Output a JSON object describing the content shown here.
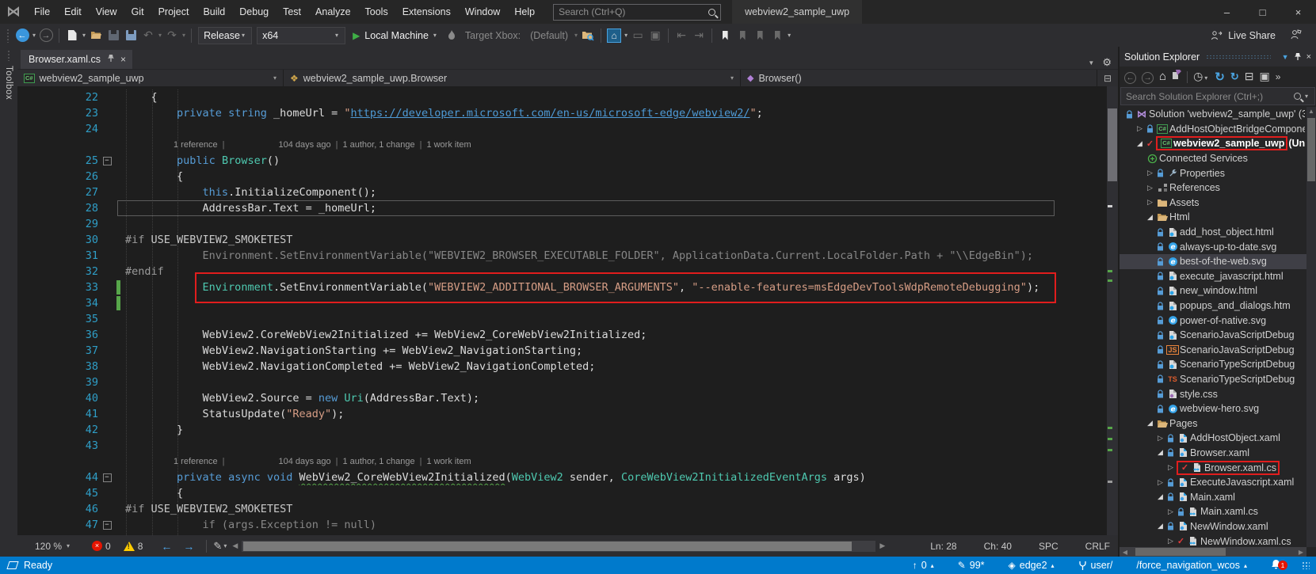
{
  "window": {
    "title": "webview2_sample_uwp",
    "search_placeholder": "Search (Ctrl+Q)",
    "controls": {
      "minimize": "–",
      "maximize": "□",
      "close": "×"
    }
  },
  "menubar": {
    "items": [
      "File",
      "Edit",
      "View",
      "Git",
      "Project",
      "Build",
      "Debug",
      "Test",
      "Analyze",
      "Tools",
      "Extensions",
      "Window",
      "Help"
    ]
  },
  "toolbar": {
    "configuration": "Release",
    "platform": "x64",
    "run_target": "Local Machine",
    "target_label": "Target Xbox:",
    "target_value": "(Default)",
    "live_share": "Live Share",
    "icons": [
      "nav-back",
      "nav-forward",
      "new-project",
      "open-file",
      "save",
      "save-all",
      "undo",
      "redo",
      "performance-flame",
      "find-in-files",
      "attach-home",
      "navigate-backward-code",
      "navigate-forward-code",
      "decrease-indent",
      "increase-indent",
      "toggle-bookmark",
      "prev-bookmark",
      "next-bookmark",
      "clear-bookmarks",
      "live-share",
      "feedback"
    ]
  },
  "editor": {
    "toolbox_label": "Toolbox",
    "tab": {
      "label": "Browser.xaml.cs"
    },
    "breadcrumbs": [
      {
        "label": "webview2_sample_uwp",
        "icon": "csproj"
      },
      {
        "label": "webview2_sample_uwp.Browser",
        "icon": "class"
      },
      {
        "label": "Browser()",
        "icon": "method"
      }
    ],
    "codelens": {
      "references": "1 reference",
      "age": "104 days ago",
      "authors": "1 author, 1 change",
      "work_items": "1 work item",
      "sep": "|"
    },
    "lines": [
      {
        "n": "22",
        "i": 4,
        "t": [
          [
            "p",
            "{"
          ]
        ]
      },
      {
        "n": "23",
        "i": 8,
        "t": [
          [
            "k",
            "private"
          ],
          [
            "p",
            " "
          ],
          [
            "k",
            "string"
          ],
          [
            "p",
            " _homeUrl = "
          ],
          [
            "s",
            "\""
          ],
          [
            "lnk",
            "https://developer.microsoft.com/en-us/microsoft-edge/webview2/"
          ],
          [
            "s",
            "\""
          ],
          [
            "p",
            ";"
          ]
        ]
      },
      {
        "n": "24",
        "i": 0,
        "t": []
      },
      {
        "cl": true
      },
      {
        "n": "25",
        "i": 8,
        "fold": true,
        "t": [
          [
            "k",
            "public"
          ],
          [
            "p",
            " "
          ],
          [
            "ty",
            "Browser"
          ],
          [
            "p",
            "()"
          ]
        ]
      },
      {
        "n": "26",
        "i": 8,
        "t": [
          [
            "p",
            "{"
          ]
        ]
      },
      {
        "n": "27",
        "i": 12,
        "t": [
          [
            "k",
            "this"
          ],
          [
            "p",
            ".InitializeComponent();"
          ]
        ]
      },
      {
        "n": "28",
        "i": 12,
        "cur": true,
        "t": [
          [
            "p",
            "AddressBar.Text = _homeUrl;"
          ]
        ]
      },
      {
        "n": "29",
        "i": 0,
        "t": []
      },
      {
        "n": "30",
        "i": 0,
        "t": [
          [
            "pre",
            "#if"
          ],
          [
            "pd",
            " USE_WEBVIEW2_SMOKETEST"
          ]
        ]
      },
      {
        "n": "31",
        "i": 12,
        "t": [
          [
            "dim",
            "Environment.SetEnvironmentVariable(\"WEBVIEW2_BROWSER_EXECUTABLE_FOLDER\", ApplicationData.Current.LocalFolder.Path + \"\\\\EdgeBin\");"
          ]
        ]
      },
      {
        "n": "32",
        "i": 0,
        "t": [
          [
            "pre",
            "#endif"
          ]
        ]
      },
      {
        "n": "33",
        "i": 12,
        "box": true,
        "bar": true,
        "t": [
          [
            "ty",
            "Environment"
          ],
          [
            "p",
            "."
          ],
          [
            "m",
            "SetEnvironmentVariable"
          ],
          [
            "p",
            "("
          ],
          [
            "s",
            "\"WEBVIEW2_ADDITIONAL_BROWSER_ARGUMENTS\""
          ],
          [
            "p",
            ", "
          ],
          [
            "s",
            "\"--enable-features=msEdgeDevToolsWdpRemoteDebugging\""
          ],
          [
            "p",
            ");"
          ]
        ]
      },
      {
        "n": "34",
        "i": 0,
        "bar": true,
        "t": []
      },
      {
        "n": "35",
        "i": 0,
        "t": []
      },
      {
        "n": "36",
        "i": 12,
        "t": [
          [
            "p",
            "WebView2.CoreWebView2Initialized += WebView2_CoreWebView2Initialized;"
          ]
        ]
      },
      {
        "n": "37",
        "i": 12,
        "t": [
          [
            "p",
            "WebView2.NavigationStarting += WebView2_NavigationStarting;"
          ]
        ]
      },
      {
        "n": "38",
        "i": 12,
        "t": [
          [
            "p",
            "WebView2.NavigationCompleted += WebView2_NavigationCompleted;"
          ]
        ]
      },
      {
        "n": "39",
        "i": 0,
        "t": []
      },
      {
        "n": "40",
        "i": 12,
        "t": [
          [
            "p",
            "WebView2.Source = "
          ],
          [
            "k",
            "new"
          ],
          [
            "p",
            " "
          ],
          [
            "ty",
            "Uri"
          ],
          [
            "p",
            "(AddressBar.Text);"
          ]
        ]
      },
      {
        "n": "41",
        "i": 12,
        "t": [
          [
            "p",
            "StatusUpdate("
          ],
          [
            "s",
            "\"Ready\""
          ],
          [
            "p",
            ");"
          ]
        ]
      },
      {
        "n": "42",
        "i": 8,
        "t": [
          [
            "p",
            "}"
          ]
        ]
      },
      {
        "n": "43",
        "i": 0,
        "t": []
      },
      {
        "cl": true
      },
      {
        "n": "44",
        "i": 8,
        "fold": true,
        "t": [
          [
            "k",
            "private"
          ],
          [
            "p",
            " "
          ],
          [
            "k",
            "async"
          ],
          [
            "p",
            " "
          ],
          [
            "k",
            "void"
          ],
          [
            "p",
            " "
          ],
          [
            "sq",
            "WebView2_CoreWebView2Initialized"
          ],
          [
            "p",
            "("
          ],
          [
            "ty",
            "WebView2"
          ],
          [
            "p",
            " sender, "
          ],
          [
            "ty",
            "CoreWebView2InitializedEventArgs"
          ],
          [
            "p",
            " args)"
          ]
        ]
      },
      {
        "n": "45",
        "i": 8,
        "t": [
          [
            "p",
            "{"
          ]
        ]
      },
      {
        "n": "46",
        "i": 0,
        "t": [
          [
            "pre",
            "#if"
          ],
          [
            "pd",
            " USE_WEBVIEW2_SMOKETEST"
          ]
        ]
      },
      {
        "n": "47",
        "i": 12,
        "fold": true,
        "t": [
          [
            "dim",
            "if (args.Exception != null)"
          ]
        ]
      }
    ],
    "status": {
      "zoom": "120 %",
      "errors": "0",
      "warnings": "8",
      "line": "Ln: 28",
      "column": "Ch: 40",
      "spaces": "SPC",
      "line_endings": "CRLF"
    }
  },
  "solution_explorer": {
    "title": "Solution Explorer",
    "search_placeholder": "Search Solution Explorer (Ctrl+;)",
    "toolbar_icons": [
      "back",
      "forward",
      "home",
      "switch-views",
      "pending-changes-filter",
      "refresh",
      "sync-with-active-document",
      "collapse-all",
      "properties",
      "overflow"
    ],
    "items": [
      {
        "lvl": 0,
        "lock": true,
        "icon": "sln",
        "label": "Solution 'webview2_sample_uwp' (3"
      },
      {
        "lvl": 1,
        "chev": "c",
        "lock": true,
        "icon": "csproj",
        "label": "AddHostObjectBridgeCompone"
      },
      {
        "lvl": 1,
        "chev": "e",
        "check": true,
        "icon": "csproj",
        "label": "webview2_sample_uwp",
        "suffix": " (Unive",
        "bold": true,
        "box": "icon-label"
      },
      {
        "lvl": 2,
        "icon": "connected",
        "label": "Connected Services"
      },
      {
        "lvl": 2,
        "chev": "c",
        "lock": true,
        "icon": "wrench",
        "label": "Properties"
      },
      {
        "lvl": 2,
        "chev": "c",
        "icon": "refs",
        "label": "References"
      },
      {
        "lvl": 2,
        "chev": "c",
        "icon": "folder",
        "label": "Assets"
      },
      {
        "lvl": 2,
        "chev": "e",
        "icon": "folder-open",
        "label": "Html"
      },
      {
        "lvl": 3,
        "lock": true,
        "icon": "html",
        "label": "add_host_object.html"
      },
      {
        "lvl": 3,
        "lock": true,
        "icon": "ie",
        "label": "always-up-to-date.svg"
      },
      {
        "lvl": 3,
        "lock": true,
        "icon": "ie",
        "label": "best-of-the-web.svg",
        "selected": true
      },
      {
        "lvl": 3,
        "lock": true,
        "icon": "html",
        "label": "execute_javascript.html"
      },
      {
        "lvl": 3,
        "lock": true,
        "icon": "html",
        "label": "new_window.html"
      },
      {
        "lvl": 3,
        "lock": true,
        "icon": "html",
        "label": "popups_and_dialogs.htm"
      },
      {
        "lvl": 3,
        "lock": true,
        "icon": "ie",
        "label": "power-of-native.svg"
      },
      {
        "lvl": 3,
        "lock": true,
        "icon": "html",
        "label": "ScenarioJavaScriptDebug"
      },
      {
        "lvl": 3,
        "lock": true,
        "icon": "js",
        "label": "ScenarioJavaScriptDebug"
      },
      {
        "lvl": 3,
        "lock": true,
        "icon": "html",
        "label": "ScenarioTypeScriptDebug"
      },
      {
        "lvl": 3,
        "lock": true,
        "icon": "ts",
        "label": "ScenarioTypeScriptDebug"
      },
      {
        "lvl": 3,
        "lock": true,
        "icon": "css",
        "label": "style.css"
      },
      {
        "lvl": 3,
        "lock": true,
        "icon": "ie",
        "label": "webview-hero.svg"
      },
      {
        "lvl": 2,
        "chev": "e",
        "icon": "folder-open",
        "label": "Pages"
      },
      {
        "lvl": 3,
        "chev": "c",
        "lock": true,
        "icon": "xaml",
        "label": "AddHostObject.xaml"
      },
      {
        "lvl": 3,
        "chev": "e",
        "lock": true,
        "icon": "xaml",
        "label": "Browser.xaml"
      },
      {
        "lvl": 4,
        "chev": "c",
        "check": true,
        "icon": "cs",
        "label": "Browser.xaml.cs",
        "box": "check-icon-label"
      },
      {
        "lvl": 3,
        "chev": "c",
        "lock": true,
        "icon": "xaml",
        "label": "ExecuteJavascript.xaml"
      },
      {
        "lvl": 3,
        "chev": "e",
        "lock": true,
        "icon": "xaml",
        "label": "Main.xaml"
      },
      {
        "lvl": 4,
        "chev": "c",
        "lock": true,
        "icon": "cs",
        "label": "Main.xaml.cs"
      },
      {
        "lvl": 3,
        "chev": "e",
        "lock": true,
        "icon": "xaml",
        "label": "NewWindow.xaml"
      },
      {
        "lvl": 4,
        "chev": "c",
        "check": true,
        "icon": "cs",
        "label": "NewWindow.xaml.cs"
      }
    ]
  },
  "statusbar": {
    "ready": "Ready",
    "right": [
      {
        "name": "pending-changes",
        "icon": "arrow-up",
        "text": "0",
        "caret": true
      },
      {
        "name": "unpushed-edits",
        "icon": "pencil",
        "text": "99*"
      },
      {
        "name": "current-branch",
        "icon": "commit",
        "text": "edge2",
        "caret": true
      },
      {
        "name": "current-repo",
        "icon": "fork",
        "text": "user/"
      },
      {
        "name": "branch-nav",
        "icon": "",
        "text": "/force_navigation_wcos",
        "caret": true
      }
    ],
    "notifications_badge": "1"
  },
  "colors": {
    "accent": "#007acc",
    "annotation_red": "#e11d1d",
    "error_red": "#e51400",
    "warning_yellow": "#ffcc00",
    "change_bar_green": "#57a64a",
    "line_number_blue": "#2f9ec7"
  }
}
